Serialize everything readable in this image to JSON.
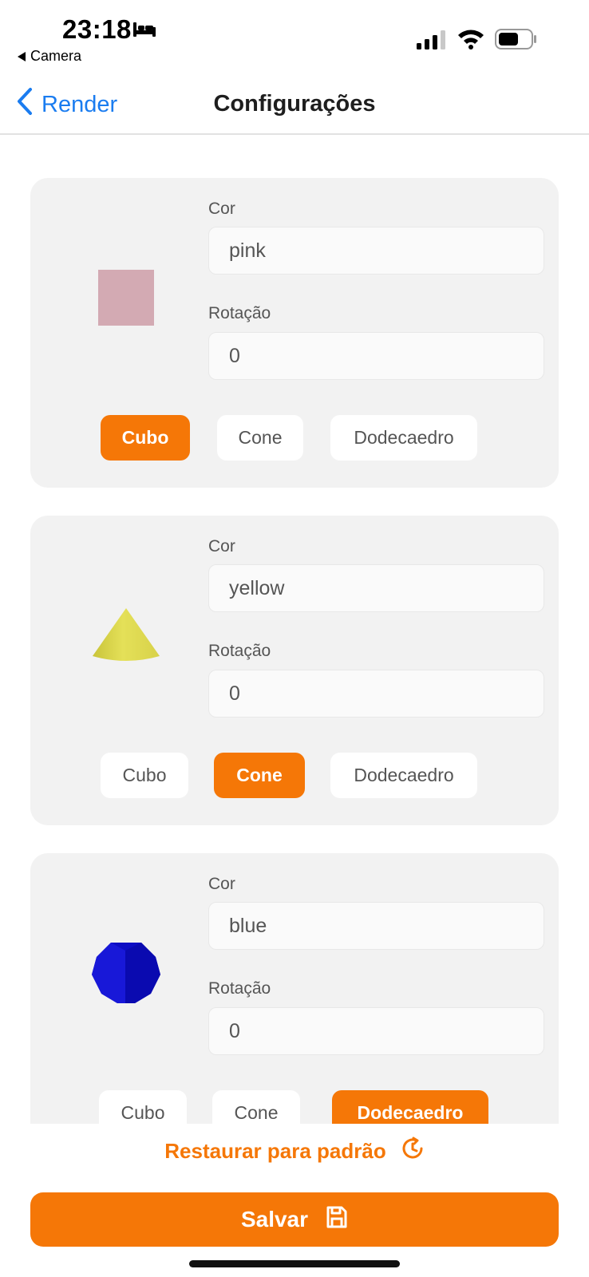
{
  "status_bar": {
    "time": "23:18",
    "back_app": "Camera"
  },
  "nav": {
    "back_label": "Render",
    "title": "Configurações"
  },
  "objects": [
    {
      "shape": "cube",
      "color_label": "Cor",
      "color_value": "pink",
      "rotation_label": "Rotação",
      "rotation_value": "0",
      "selected": "Cubo",
      "preview_color": "#d3aab3"
    },
    {
      "shape": "cone",
      "color_label": "Cor",
      "color_value": "yellow",
      "rotation_label": "Rotação",
      "rotation_value": "0",
      "selected": "Cone",
      "preview_color": "#e0de4f"
    },
    {
      "shape": "dodecahedron",
      "color_label": "Cor",
      "color_value": "blue",
      "rotation_label": "Rotação",
      "rotation_value": "0",
      "selected": "Dodecaedro",
      "preview_color": "#1010c8"
    }
  ],
  "shape_options": [
    "Cubo",
    "Cone",
    "Dodecaedro"
  ],
  "footer": {
    "restore_label": "Restaurar para padrão",
    "save_label": "Salvar"
  },
  "colors": {
    "accent": "#f57707",
    "link": "#1a7cf0",
    "card_bg": "#f2f2f2"
  }
}
